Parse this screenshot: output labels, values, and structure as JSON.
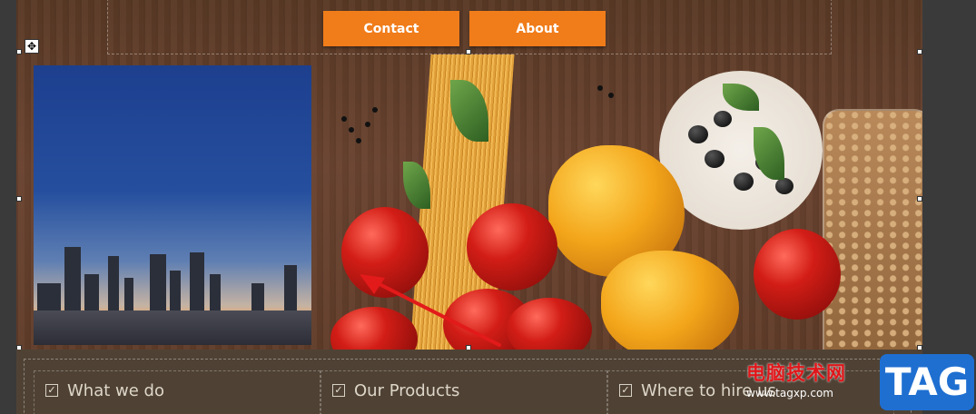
{
  "nav": {
    "contact_label": "Contact",
    "about_label": "About"
  },
  "features": [
    {
      "label": "What we do"
    },
    {
      "label": "Our Products"
    },
    {
      "label": "Where to hire us"
    }
  ],
  "watermark": {
    "site_name": "电脑技术网",
    "url": "www.tagxp.com",
    "logo_text": "TAG"
  },
  "colors": {
    "accent": "#f07c1a",
    "band": "#4f4234",
    "annotation": "#e21a1a",
    "watermark_blue": "#1f6fd1"
  },
  "icons": {
    "move_handle": "move-icon",
    "feature_check": "checkbox-icon",
    "arrow": "red-arrow-annotation"
  }
}
